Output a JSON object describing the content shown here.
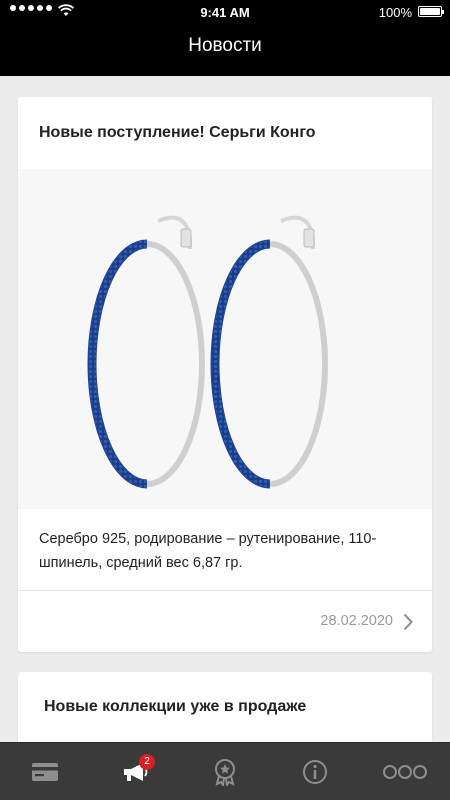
{
  "status_bar": {
    "time": "9:41 AM",
    "battery_percent": "100%",
    "battery_level": 1.0,
    "signal_icon": "signal-dots-icon",
    "wifi_icon": "wifi-icon"
  },
  "nav": {
    "title": "Новости"
  },
  "news": [
    {
      "title": "Новые поступление! Серьги Конго",
      "image_alt": "hoop-earrings-image",
      "text": "Серебро 925, родирование – рутенирование, 110-шпинель, средний вес 6,87 гр.",
      "date": "28.02.2020",
      "chevron_icon": "chevron-right-icon"
    },
    {
      "title": "Новые коллекции уже в продаже"
    }
  ],
  "tab_bar": {
    "tabs": [
      {
        "icon": "card-icon",
        "active": false
      },
      {
        "icon": "megaphone-icon",
        "active": true,
        "badge": "2"
      },
      {
        "icon": "award-icon",
        "active": false
      },
      {
        "icon": "info-icon",
        "active": false
      },
      {
        "icon": "more-dots-icon",
        "active": false
      }
    ]
  },
  "colors": {
    "header_bg": "#000000",
    "tab_bar_bg": "#3a3a3a",
    "badge_bg": "#d81e27",
    "page_bg": "#ececec",
    "card_bg": "#ffffff",
    "date_text": "#9a9a9a",
    "tab_icon_inactive": "#8e8e8e",
    "tab_icon_active": "#ffffff"
  }
}
